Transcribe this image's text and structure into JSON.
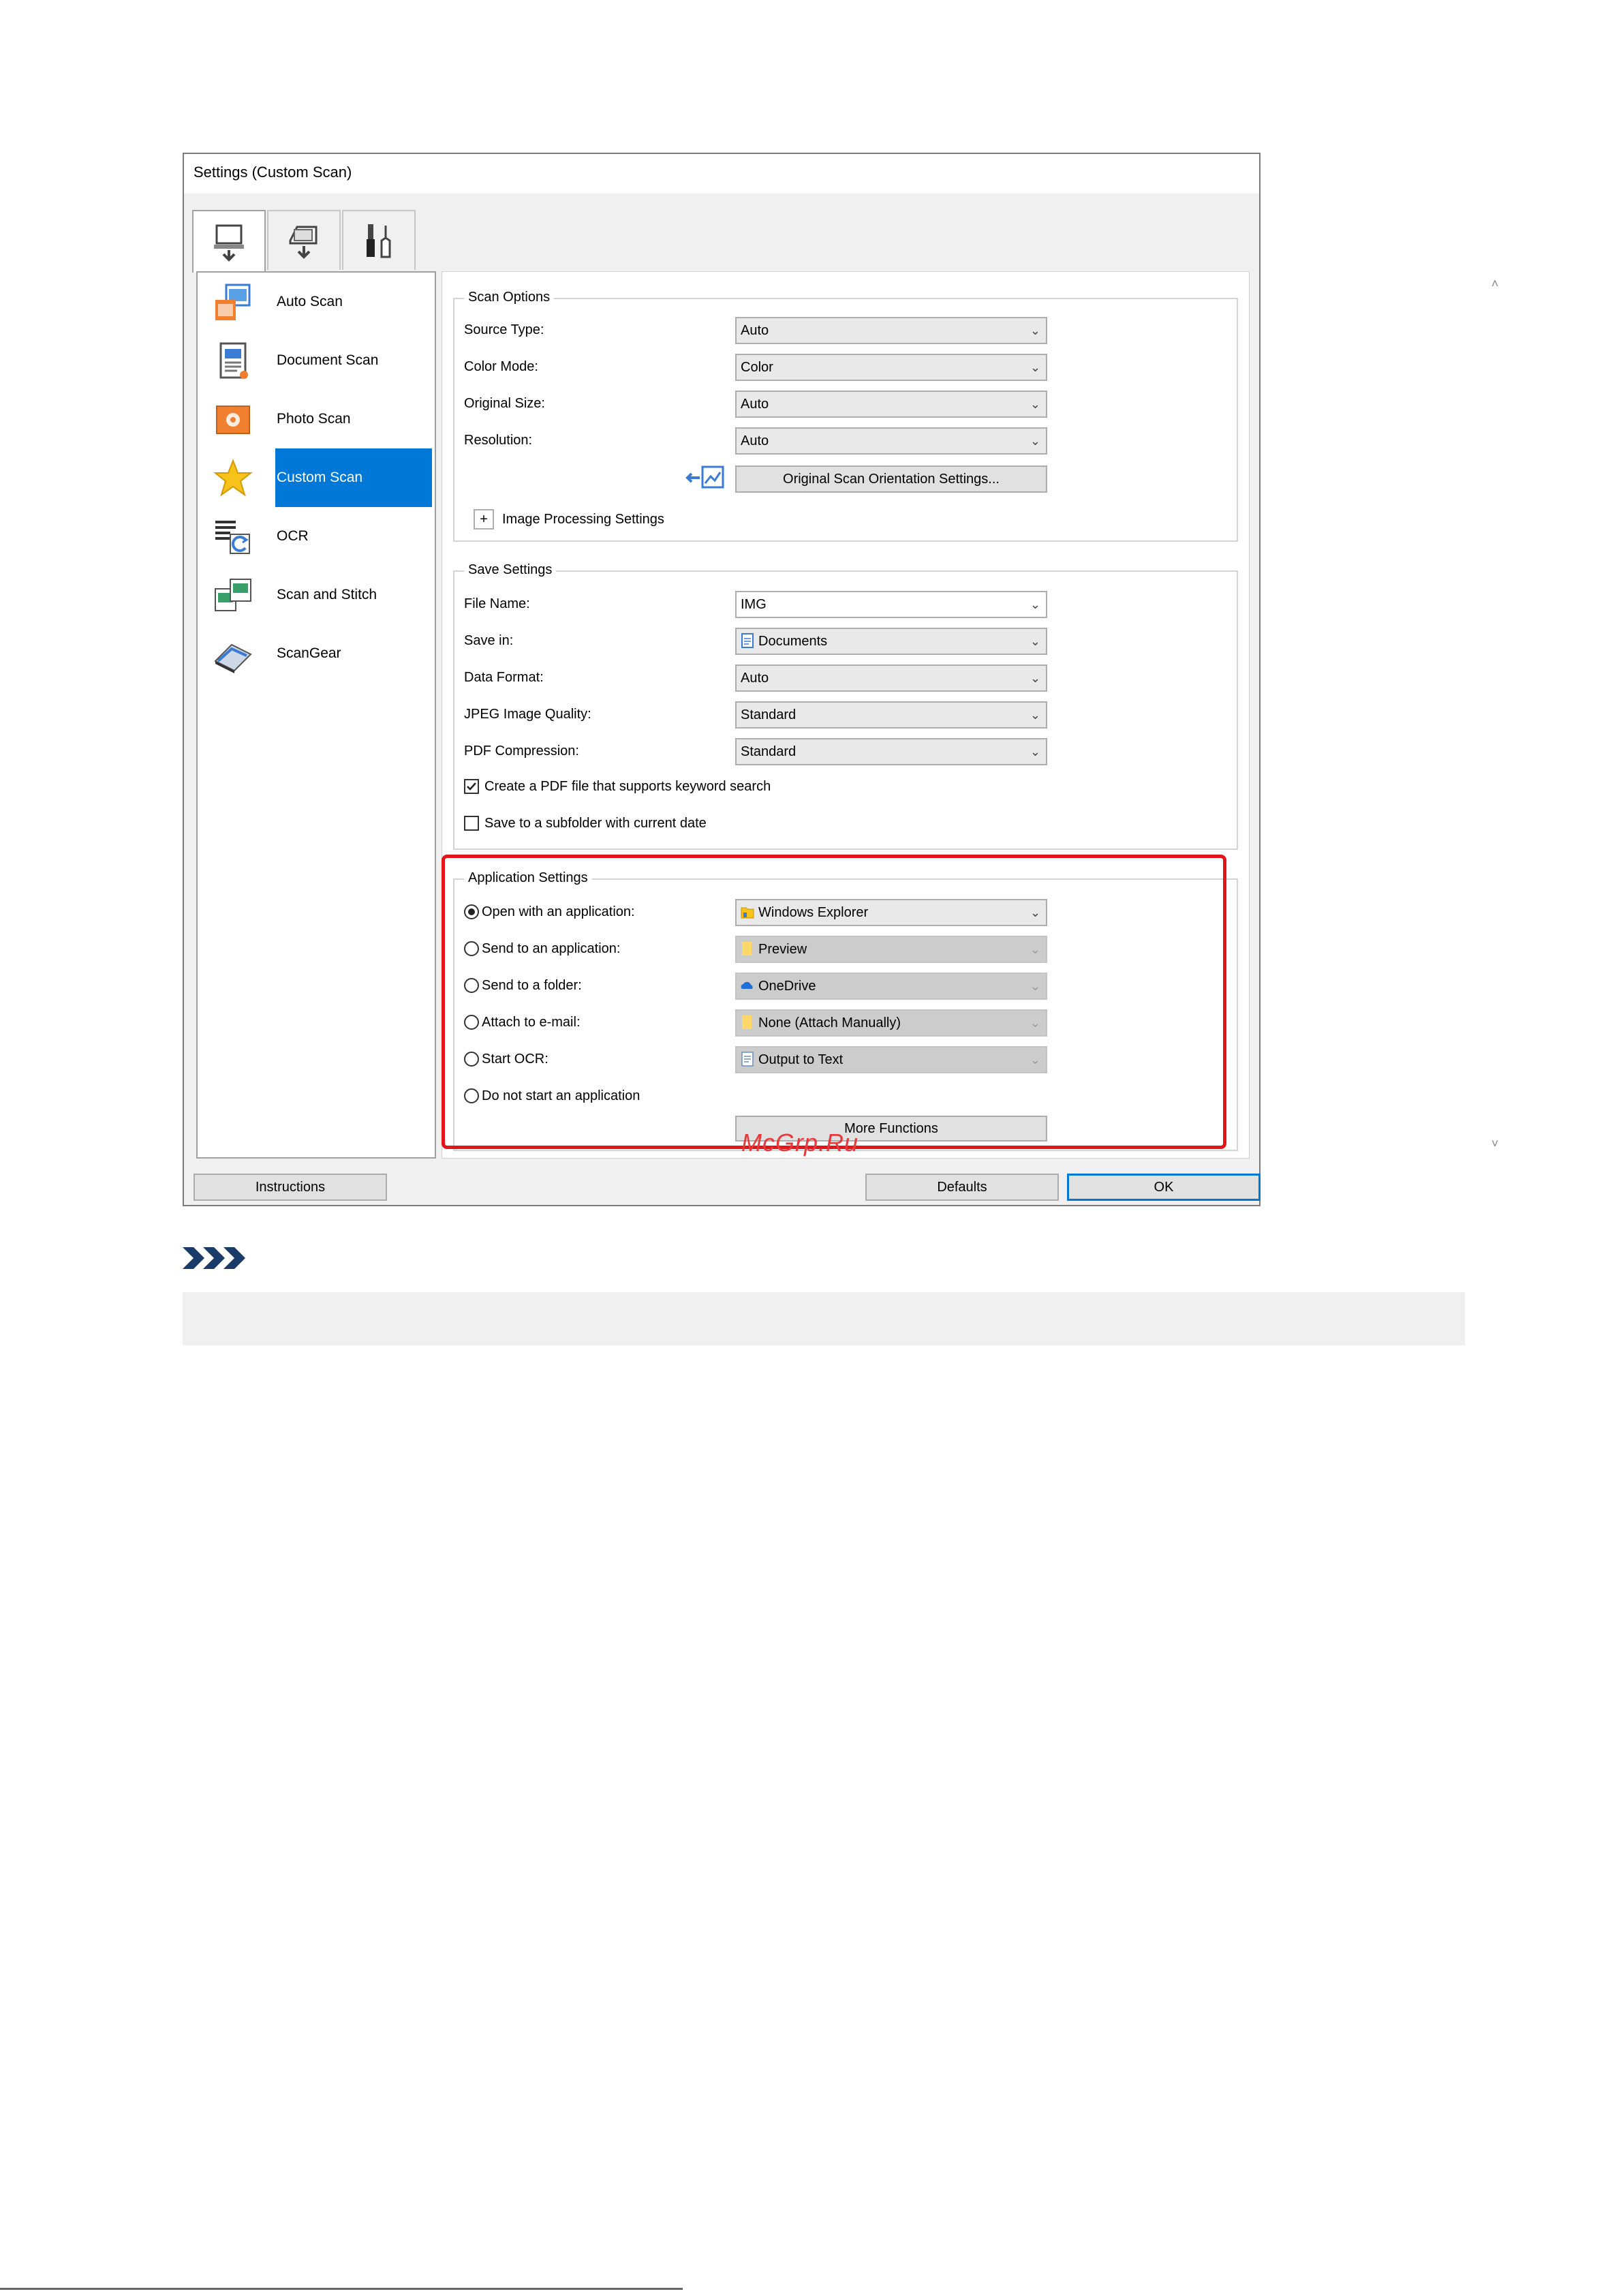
{
  "window": {
    "title": "Settings (Custom Scan)"
  },
  "top_tabs": [
    {
      "icon": "computer-scan-icon"
    },
    {
      "icon": "scan-from-panel-icon"
    },
    {
      "icon": "general-settings-icon"
    }
  ],
  "sidebar": {
    "items": [
      {
        "label": "Auto Scan",
        "icon": "auto-scan-icon"
      },
      {
        "label": "Document Scan",
        "icon": "document-scan-icon"
      },
      {
        "label": "Photo Scan",
        "icon": "photo-scan-icon"
      },
      {
        "label": "Custom Scan",
        "icon": "star-icon",
        "selected": true
      },
      {
        "label": "OCR",
        "icon": "ocr-icon"
      },
      {
        "label": "Scan and Stitch",
        "icon": "scan-and-stitch-icon"
      },
      {
        "label": "ScanGear",
        "icon": "scanner-icon"
      }
    ]
  },
  "scan_options": {
    "title": "Scan Options",
    "source_type": {
      "label": "Source Type:",
      "value": "Auto"
    },
    "color_mode": {
      "label": "Color Mode:",
      "value": "Color"
    },
    "original_size": {
      "label": "Original Size:",
      "value": "Auto"
    },
    "resolution": {
      "label": "Resolution:",
      "value": "Auto"
    },
    "orientation_button": "Original Scan Orientation Settings...",
    "image_processing": {
      "expand": "+",
      "label": "Image Processing Settings"
    }
  },
  "save_settings": {
    "title": "Save Settings",
    "file_name": {
      "label": "File Name:",
      "value": "IMG"
    },
    "save_in": {
      "label": "Save in:",
      "value": "Documents"
    },
    "data_format": {
      "label": "Data Format:",
      "value": "Auto"
    },
    "jpeg_quality": {
      "label": "JPEG Image Quality:",
      "value": "Standard"
    },
    "pdf_compression": {
      "label": "PDF Compression:",
      "value": "Standard"
    },
    "keyword_search": {
      "label": "Create a PDF file that supports keyword search",
      "checked": true
    },
    "subfolder": {
      "label": "Save to a subfolder with current date",
      "checked": false
    }
  },
  "application_settings": {
    "title": "Application Settings",
    "options": [
      {
        "label": "Open with an application:",
        "selected": true,
        "value": "Windows Explorer",
        "enabled": true
      },
      {
        "label": "Send to an application:",
        "selected": false,
        "value": "Preview",
        "enabled": false
      },
      {
        "label": "Send to a folder:",
        "selected": false,
        "value": "OneDrive",
        "enabled": false
      },
      {
        "label": "Attach to e-mail:",
        "selected": false,
        "value": "None (Attach Manually)",
        "enabled": false
      },
      {
        "label": "Start OCR:",
        "selected": false,
        "value": "Output to Text",
        "enabled": false
      },
      {
        "label": "Do not start an application",
        "selected": false
      }
    ],
    "more_functions": "More Functions"
  },
  "footer": {
    "instructions": "Instructions",
    "defaults": "Defaults",
    "ok": "OK"
  },
  "watermark": "McGrp.Ru",
  "colors": {
    "selection": "#0078d7",
    "highlight": "#e4141b"
  }
}
